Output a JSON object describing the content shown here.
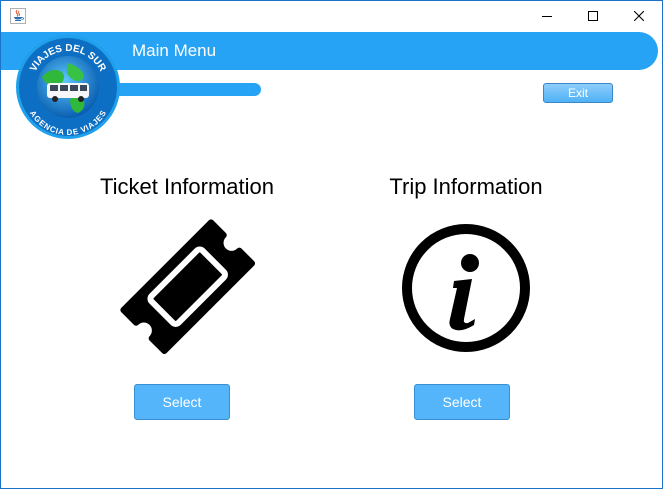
{
  "window": {
    "controls": {
      "minimize_icon": "minimize-icon",
      "maximize_icon": "maximize-icon",
      "close_icon": "close-icon"
    },
    "app_icon": "java-icon"
  },
  "header": {
    "title": "Main Menu",
    "logo": {
      "top_text": "VIAJES DEL SUR",
      "bottom_text": "AGENCIA DE VIAJES"
    },
    "exit_label": "Exit"
  },
  "sections": [
    {
      "heading": "Ticket Information",
      "icon": "ticket-icon",
      "button_label": "Select"
    },
    {
      "heading": "Trip Information",
      "icon": "info-icon",
      "button_label": "Select"
    }
  ],
  "colors": {
    "accent": "#27a3f6",
    "button": "#55b5fa",
    "window_border": "#1a73c8"
  }
}
